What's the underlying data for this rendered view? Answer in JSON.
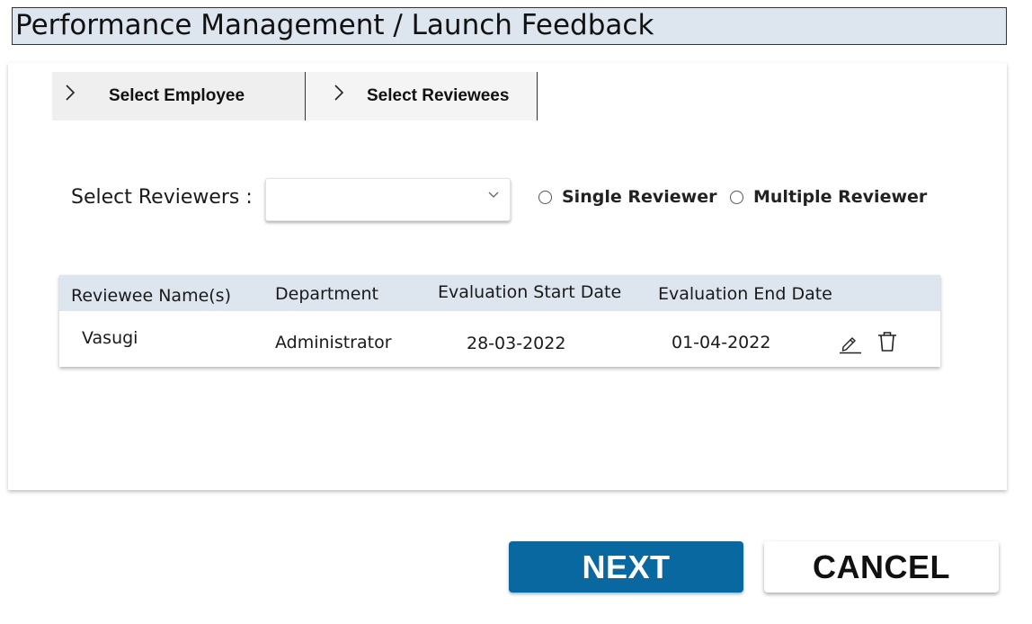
{
  "header": {
    "title": "Performance Management / Launch Feedback"
  },
  "steps": [
    {
      "label": "Select Employee",
      "icon": "chevron-right-icon"
    },
    {
      "label": "Select Reviewees",
      "icon": "chevron-right-icon"
    }
  ],
  "reviewers": {
    "label": "Select Reviewers :",
    "selected_value": "",
    "dropdown_icon": "chevron-down-icon",
    "options": [
      {
        "label": "Single Reviewer",
        "checked": false
      },
      {
        "label": "Multiple Reviewer",
        "checked": false
      }
    ]
  },
  "table": {
    "columns": [
      "Reviewee Name(s)",
      "Department",
      "Evaluation Start Date",
      "Evaluation End Date"
    ],
    "rows": [
      {
        "name": "Vasugi",
        "department": "Administrator",
        "start_date": "28-03-2022",
        "end_date": "01-04-2022",
        "actions": [
          "edit-icon",
          "trash-icon"
        ]
      }
    ]
  },
  "footer": {
    "next_label": "NEXT",
    "cancel_label": "CANCEL"
  },
  "colors": {
    "header_bg": "#dde5ef",
    "primary": "#0a68a0",
    "step_bg": "#efefef"
  }
}
